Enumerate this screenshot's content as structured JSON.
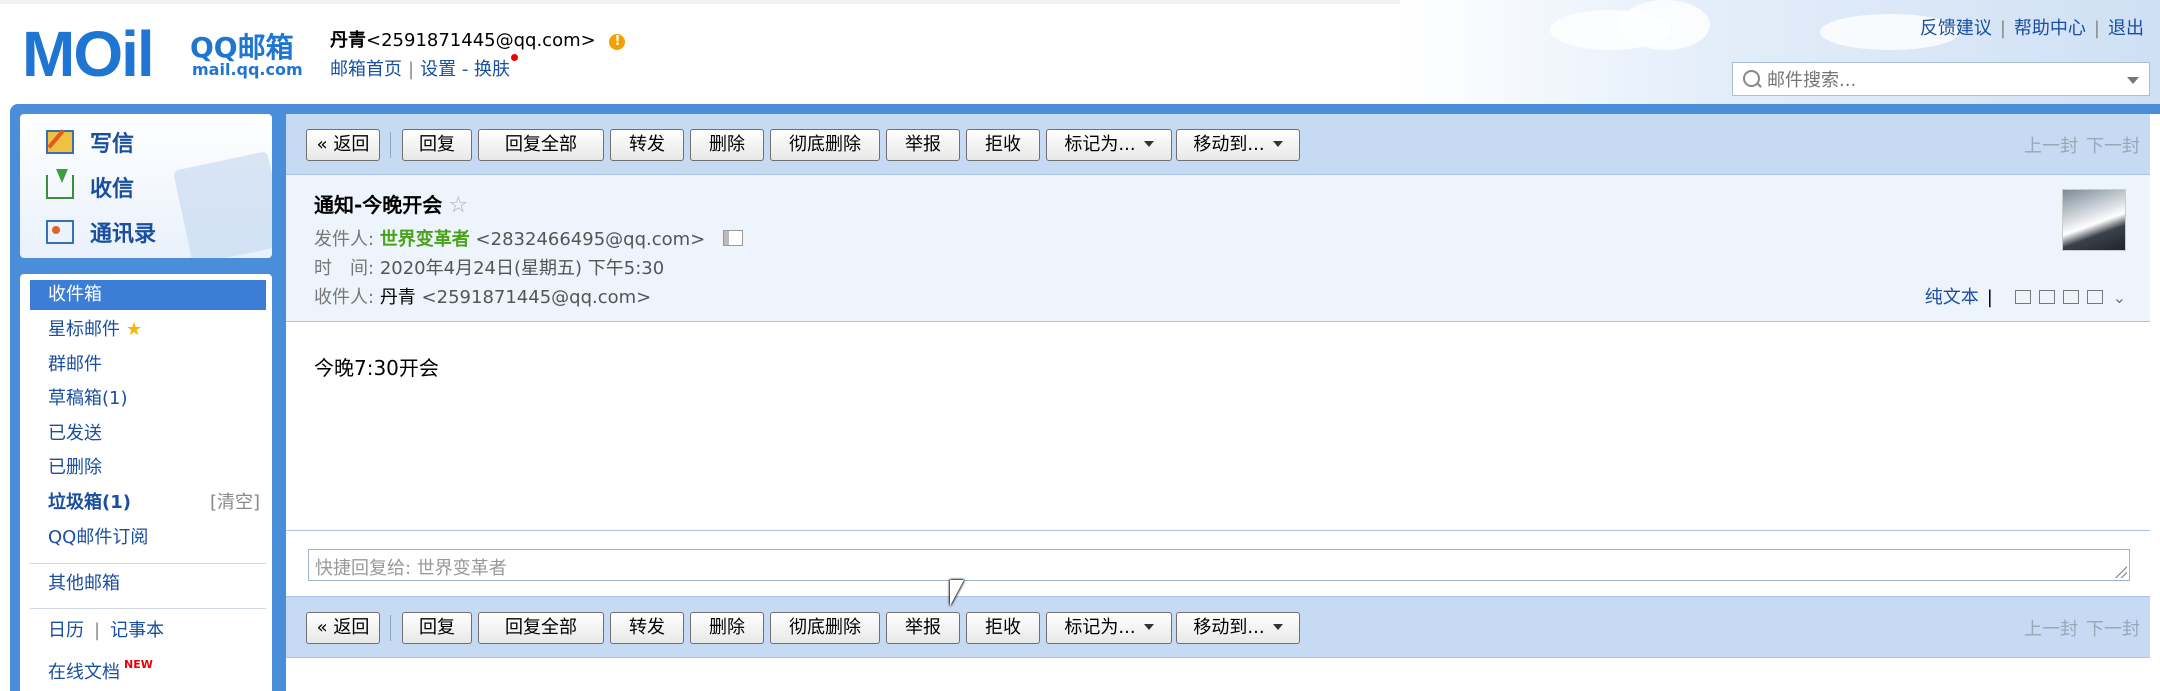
{
  "header": {
    "logo_text": "MOil",
    "brand": "QQ邮箱",
    "domain": "mail.qq.com",
    "user_name": "丹青",
    "user_email": "<2591871445@qq.com>",
    "links": {
      "home": "邮箱首页",
      "settings": "设置",
      "skin_sep": "-",
      "skin": "换肤"
    },
    "top_links": {
      "feedback": "反馈建议",
      "help": "帮助中心",
      "logout": "退出"
    },
    "search_placeholder": "邮件搜索..."
  },
  "quick_actions": {
    "write": "写信",
    "inbox": "收信",
    "contacts": "通讯录"
  },
  "folders": {
    "inbox": "收件箱",
    "starred": "星标邮件",
    "group": "群邮件",
    "drafts": "草稿箱(1)",
    "sent": "已发送",
    "deleted": "已删除",
    "spam": "垃圾箱(1)",
    "spam_clear": "[清空]",
    "subscriptions": "QQ邮件订阅",
    "other": "其他邮箱",
    "calendar": "日历",
    "notes": "记事本",
    "docs": "在线文档",
    "docs_badge": "NEW"
  },
  "toolbar": {
    "back": "« 返回",
    "reply": "回复",
    "reply_all": "回复全部",
    "forward": "转发",
    "delete": "删除",
    "delete_perm": "彻底删除",
    "report": "举报",
    "reject": "拒收",
    "mark_as": "标记为...",
    "move_to": "移动到...",
    "prev": "上一封",
    "next": "下一封"
  },
  "mail": {
    "subject": "通知-今晚开会",
    "from_label": "发件人:",
    "from_name": "世界变革者",
    "from_email": "<2832466495@qq.com>",
    "time_label": "时　间:",
    "time": "2020年4月24日(星期五) 下午5:30",
    "to_label": "收件人:",
    "to_name": "丹青",
    "to_email": "<2591871445@qq.com>",
    "plain_text": "纯文本",
    "body": "今晚7:30开会"
  },
  "quick_reply_placeholder": "快捷回复给: 世界变革者",
  "colors": {
    "accent": "#3c7dd6",
    "frame": "#4a8dd8",
    "toolbar": "#c6dbf3",
    "sender": "#4aa11a",
    "link": "#1a4fa0"
  }
}
